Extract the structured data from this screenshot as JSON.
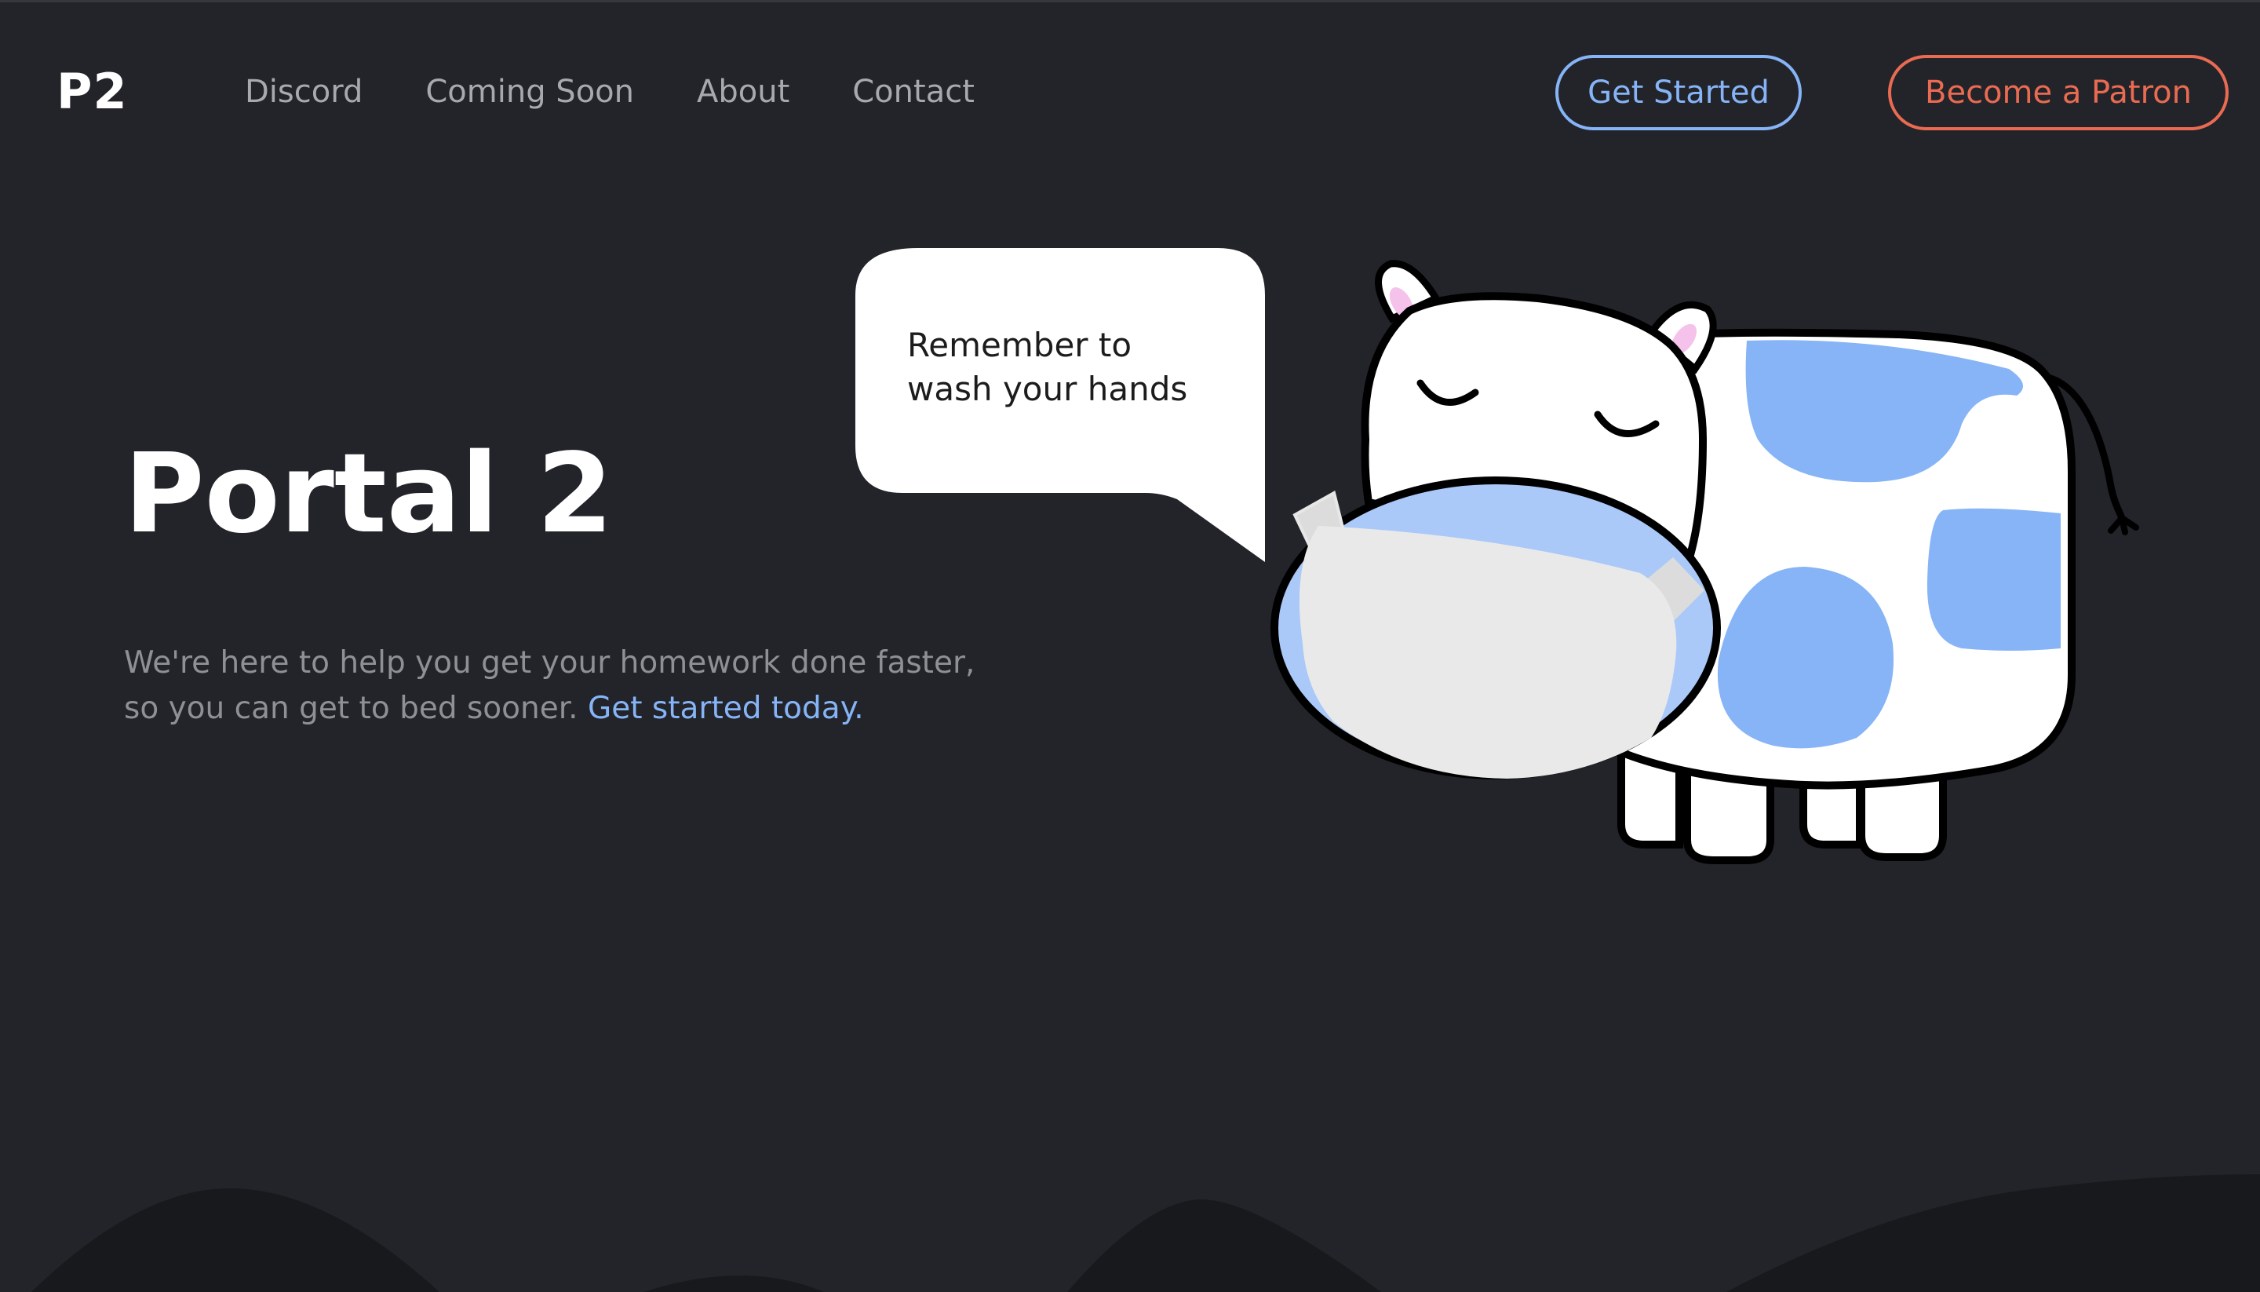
{
  "nav": {
    "logo": "P2",
    "links": [
      "Discord",
      "Coming Soon",
      "About",
      "Contact"
    ],
    "get_started": "Get Started",
    "patron": "Become a Patron"
  },
  "hero": {
    "title": "Portal 2",
    "text": "We're here to help you get your homework done faster, so you can get to bed sooner.",
    "link": "Get started today."
  },
  "bubble": {
    "line1": "Remember to",
    "line2": "wash your hands"
  },
  "colors": {
    "background": "#22242a",
    "accent_blue": "#86b4f6",
    "accent_red": "#ea6b52",
    "hills": "#18191d"
  },
  "icons": {
    "mascot": "cow-with-mask-illustration"
  }
}
